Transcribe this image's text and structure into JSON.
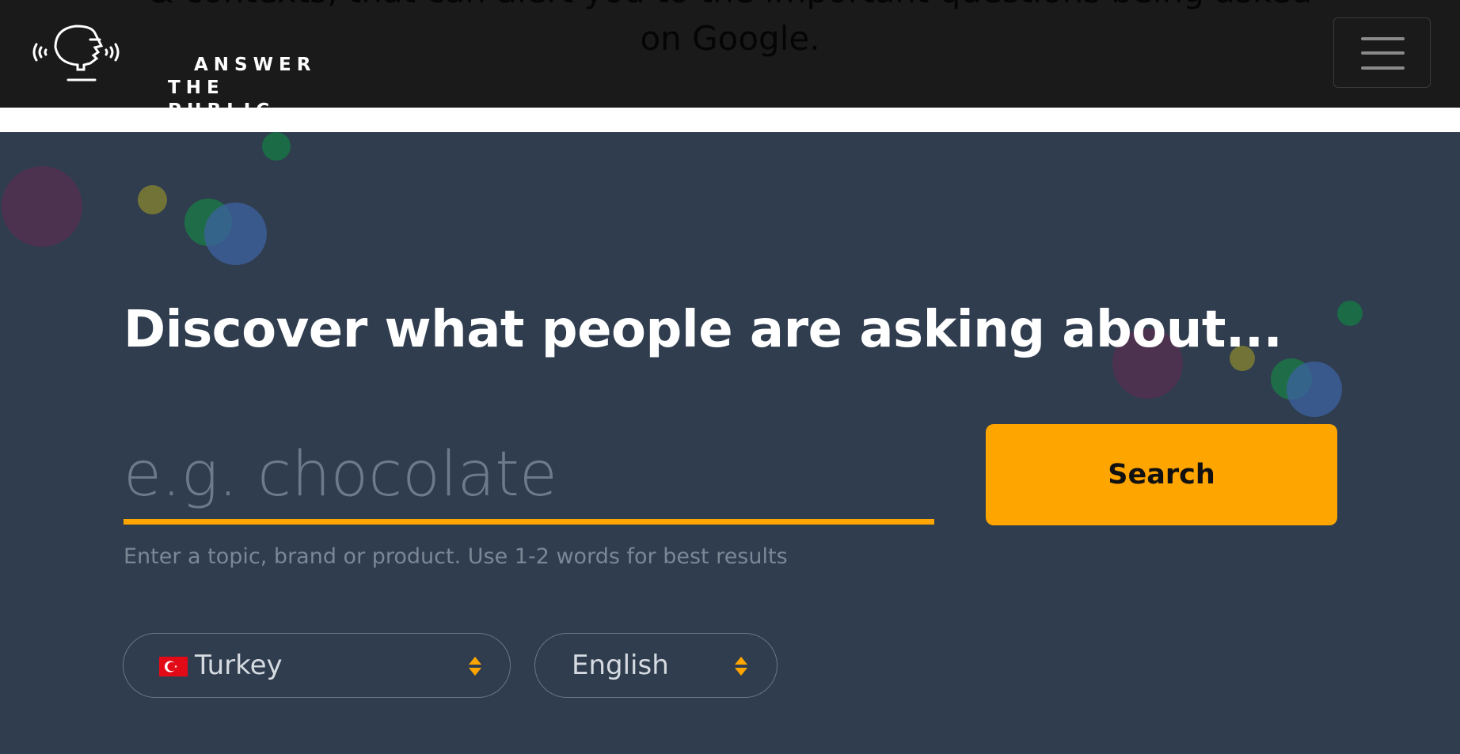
{
  "header": {
    "behind_text_line1": "& contexts, that can alert you to the important questions being asked",
    "behind_text_line2": "on Google.",
    "logo_line1": "ANSWER",
    "logo_line2": "THE PUBLIC",
    "menu_icon": "hamburger-menu-icon"
  },
  "hero": {
    "headline": "Discover what people are asking about...",
    "search": {
      "value": "",
      "placeholder": "e.g. chocolate",
      "button_label": "Search",
      "hint": "Enter a topic, brand or product. Use 1-2 words for best results"
    },
    "country": {
      "selected": "Turkey",
      "flag_icon": "turkey-flag-icon"
    },
    "language": {
      "selected": "English"
    }
  },
  "colors": {
    "header_bg": "#1a1a1a",
    "hero_bg": "#2f3d4e",
    "accent": "#ffa500",
    "headline": "#ffffff",
    "placeholder": "#6c7a89",
    "hint": "#7c8796"
  }
}
